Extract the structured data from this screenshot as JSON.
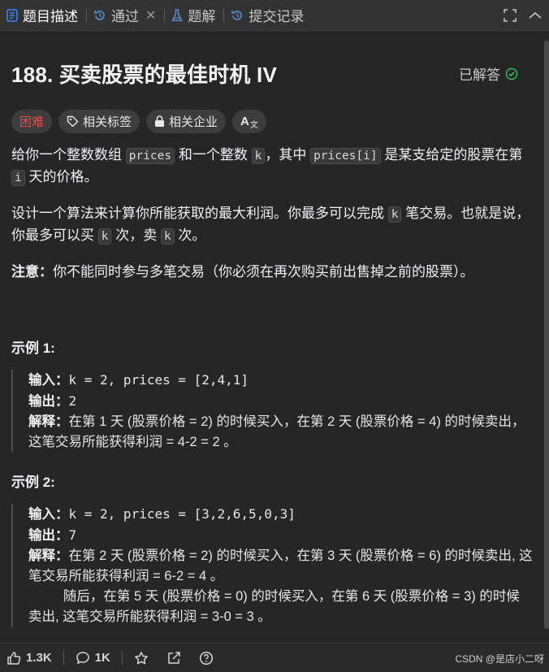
{
  "tabs": [
    {
      "label": "题目描述",
      "icon": "description-icon"
    },
    {
      "label": "通过",
      "icon": "history-icon"
    },
    {
      "label": "题解",
      "icon": "flask-icon"
    },
    {
      "label": "提交记录",
      "icon": "history-icon"
    }
  ],
  "problem": {
    "title": "188. 买卖股票的最佳时机 IV",
    "solved_label": "已解答",
    "tags": {
      "difficulty": "困难",
      "related_tags": "相关标签",
      "related_companies": "相关企业",
      "translate": "A"
    },
    "p1": {
      "a": "给你一个整数数组",
      "c1": "prices",
      "b": "和一个整数",
      "c2": "k",
      "c": "，其中",
      "c3": "prices[i]",
      "d": "是某支给定的股票在第",
      "c4": "i",
      "e": "天的价格。"
    },
    "p2": {
      "a": "设计一个算法来计算你所能获取的最大利润。你最多可以完成",
      "c1": "k",
      "b": "笔交易。也就是说，你最多可以买",
      "c2": "k",
      "c": "次，卖",
      "c3": "k",
      "d": "次。"
    },
    "p3": {
      "bold": "注意：",
      "text": "你不能同时参与多笔交易（你必须在再次购买前出售掉之前的股票）。"
    }
  },
  "examples": [
    {
      "title": "示例 1:",
      "input_label": "输入：",
      "input": "k = 2, prices = [2,4,1]",
      "output_label": "输出：",
      "output": "2",
      "explain_label": "解释：",
      "explain": "在第 1 天 (股票价格 = 2) 的时候买入，在第 2 天 (股票价格 = 4) 的时候卖出，这笔交易所能获得利润 = 4-2 = 2 。"
    },
    {
      "title": "示例 2:",
      "input_label": "输入：",
      "input": "k = 2, prices = [3,2,6,5,0,3]",
      "output_label": "输出：",
      "output": "7",
      "explain_label": "解释：",
      "explain": "在第 2 天 (股票价格 = 2) 的时候买入，在第 3 天 (股票价格 = 6) 的时候卖出, 这笔交易所能获得利润 = 6-2 = 4 。",
      "explain2": "随后，在第 5 天 (股票价格 = 0) 的时候买入，在第 6 天 (股票价格 = 3) 的时候卖出, 这笔交易所能获得利润 = 3-0 = 3 。"
    }
  ],
  "bottom": {
    "likes": "1.3K",
    "comments": "1K"
  },
  "watermark": "CSDN @是店小二呀"
}
